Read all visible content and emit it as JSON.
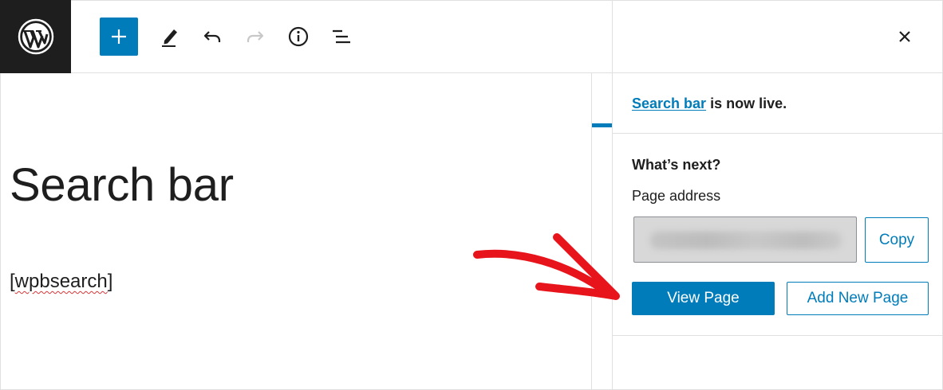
{
  "toolbar": {
    "logo": "wordpress-logo",
    "icons": [
      "plus-icon",
      "pencil-icon",
      "undo-icon",
      "redo-icon",
      "info-icon",
      "list-view-icon"
    ]
  },
  "editor": {
    "title": "Search bar",
    "shortcode_open": "[",
    "shortcode_word": "wpbsearch",
    "shortcode_close": "]"
  },
  "panel": {
    "close_icon": "close-icon",
    "live_link": "Search bar",
    "live_suffix": " is now live.",
    "next_heading": "What’s next?",
    "address_label": "Page address",
    "copy_label": "Copy",
    "view_label": "View Page",
    "add_new_label": "Add New Page"
  },
  "colors": {
    "accent": "#007cba",
    "dark": "#1e1e1e",
    "annotation_arrow": "#e8141c"
  }
}
